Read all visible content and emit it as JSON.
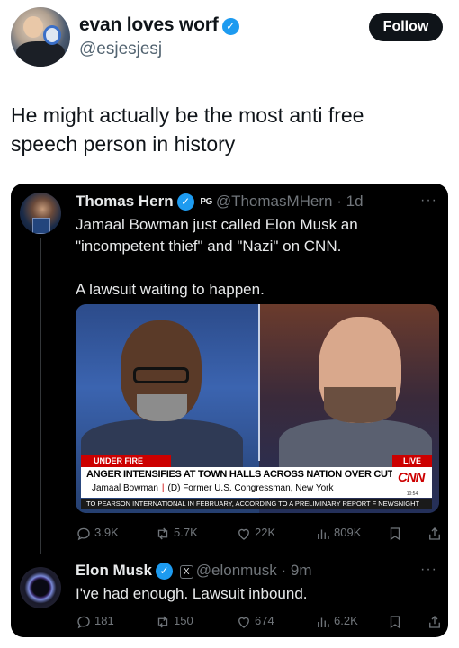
{
  "author": {
    "name": "evan loves worf",
    "handle": "@esjesjesj",
    "verified_mark": "✓",
    "follow_label": "Follow"
  },
  "post": {
    "text": "He might actually be the most anti free speech person in history"
  },
  "quoted": {
    "name": "Thomas Hern",
    "verified_mark": "✓",
    "badge": "PG",
    "handle": "@ThomasMHern",
    "time": "· 1d",
    "text": "Jamaal Bowman just called Elon Musk an \"incompetent thief\" and \"Nazi\" on CNN.\n\nA lawsuit waiting to happen.",
    "more": "···",
    "media": {
      "chyron_tag": "UNDER FIRE",
      "live": "LIVE",
      "headline": "ANGER INTENSIFIES AT TOWN HALLS ACROSS NATION OVER CUTS",
      "name": "Jamaal Bowman",
      "separator": "|",
      "title": "(D) Former U.S. Congressman, New York",
      "network": "CNN",
      "clock": "10:54",
      "ticker": "TO PEARSON INTERNATIONAL IN FEBRUARY, ACCORDING TO A PRELIMINARY REPORT F NEWSNIGHT"
    },
    "stats": {
      "replies": "3.9K",
      "reposts": "5.7K",
      "likes": "22K",
      "views": "809K"
    }
  },
  "reply": {
    "name": "Elon Musk",
    "verified_mark": "✓",
    "badge": "X",
    "handle": "@elonmusk",
    "time": "· 9m",
    "text": "I've had enough. Lawsuit inbound.",
    "more": "···",
    "stats": {
      "replies": "181",
      "reposts": "150",
      "likes": "674",
      "views": "6.2K"
    }
  },
  "colors": {
    "verified_blue": "#1d9bf0",
    "card_bg": "#000000",
    "muted_text": "#71767b",
    "cnn_red": "#cc0000"
  },
  "icons": [
    "reply-icon",
    "repost-icon",
    "like-icon",
    "views-icon",
    "bookmark-icon",
    "share-icon"
  ]
}
